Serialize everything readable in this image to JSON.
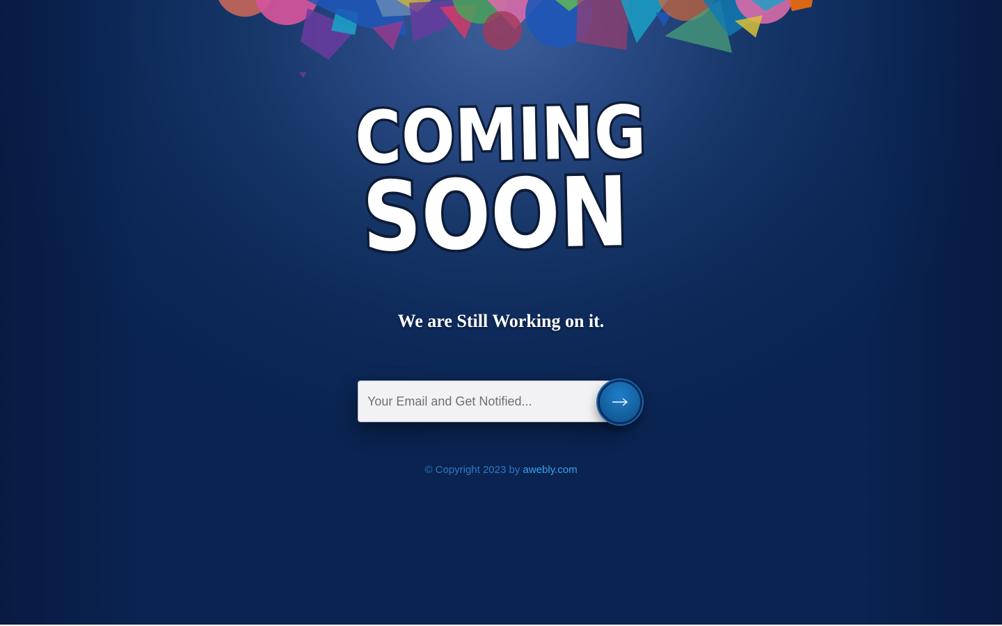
{
  "headline": {
    "line1": "COMING",
    "line2": "SOON"
  },
  "tagline": "We are Still Working on it.",
  "notify": {
    "placeholder": "Your Email and Get Notified...",
    "submit_icon": "arrow-right-icon"
  },
  "footer": {
    "copyright_text": "© Copyright 2023 by ",
    "link_text": "awebly.com"
  },
  "colors": {
    "background_top": "#3d5f99",
    "background_bottom": "#0a2350",
    "accent": "#1f7fc8",
    "footer_text": "#2c7bc9",
    "footer_link": "#3aa2ef",
    "headline_fill": "#ffffff",
    "headline_outline": "#0d1b36"
  }
}
